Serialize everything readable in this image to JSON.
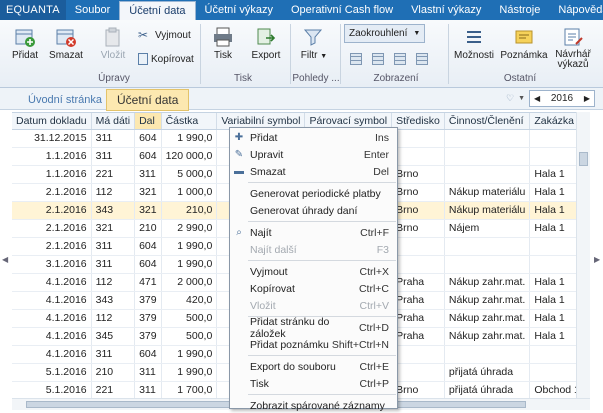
{
  "menubar": {
    "logo": "EQUANTA",
    "tabs": [
      "Soubor",
      "Účetní data",
      "Účetní výkazy",
      "Operativní Cash flow",
      "Vlastní výkazy",
      "Nástroje",
      "Nápověda"
    ]
  },
  "ribbon": {
    "pridat": "Přidat",
    "smazat": "Smazat",
    "vlozit": "Vložit",
    "vyjmout": "Vyjmout",
    "kopirovat": "Kopírovat",
    "upravy": "Úpravy",
    "tisk": "Tisk",
    "export": "Export",
    "tisk_group": "Tisk",
    "filtr": "Filtr",
    "pohledy": "Pohledy ...",
    "zaokrouhleni": "Zaokrouhlení",
    "zobrazeni": "Zobrazení",
    "moznosti": "Možnosti",
    "poznamka": "Poznámka",
    "navrhar": "Návrhář výkazů",
    "ostatni": "Ostatní"
  },
  "pagetabs": {
    "uvodni": "Úvodní stránka",
    "ucetni": "Účetní data",
    "year": "2016"
  },
  "table": {
    "columns": [
      "Datum dokladu",
      "Má dáti",
      "Dal",
      "Částka",
      "Variabilní symbol",
      "Párovací symbol",
      "Středisko",
      "Činnost/Členění",
      "Zakázka",
      "Č"
    ],
    "rows": [
      [
        "31.12.2015",
        "311",
        "604",
        "1 990,0",
        "",
        "",
        "",
        "",
        ""
      ],
      [
        "1.1.2016",
        "311",
        "604",
        "120 000,0",
        "",
        "",
        "",
        "",
        ""
      ],
      [
        "1.1.2016",
        "221",
        "311",
        "5 000,0",
        "",
        "",
        "Brno",
        "",
        "Hala 1"
      ],
      [
        "2.1.2016",
        "112",
        "321",
        "1 000,0",
        "",
        "",
        "Brno",
        "Nákup materiálu",
        "Hala 1"
      ],
      [
        "2.1.2016",
        "343",
        "321",
        "210,0",
        "",
        "",
        "Brno",
        "Nákup materiálu",
        "Hala 1"
      ],
      [
        "2.1.2016",
        "321",
        "210",
        "2 990,0",
        "",
        "",
        "Brno",
        "Nájem",
        "Hala 1"
      ],
      [
        "2.1.2016",
        "311",
        "604",
        "1 990,0",
        "",
        "",
        "",
        "",
        ""
      ],
      [
        "3.1.2016",
        "311",
        "604",
        "1 990,0",
        "",
        "",
        "",
        "",
        ""
      ],
      [
        "4.1.2016",
        "112",
        "471",
        "2 000,0",
        "",
        "",
        "Praha",
        "Nákup zahr.mat.",
        "Hala 1"
      ],
      [
        "4.1.2016",
        "343",
        "379",
        "420,0",
        "",
        "",
        "Praha",
        "Nákup zahr.mat.",
        "Hala 1"
      ],
      [
        "4.1.2016",
        "112",
        "379",
        "500,0",
        "",
        "",
        "Praha",
        "Nákup zahr.mat.",
        "Hala 1"
      ],
      [
        "4.1.2016",
        "345",
        "379",
        "500,0",
        "",
        "",
        "Praha",
        "Nákup zahr.mat.",
        "Hala 1"
      ],
      [
        "4.1.2016",
        "311",
        "604",
        "1 990,0",
        "",
        "",
        "",
        "",
        ""
      ],
      [
        "5.1.2016",
        "210",
        "311",
        "1 990,0",
        "",
        "",
        "",
        "přijatá úhrada",
        ""
      ],
      [
        "5.1.2016",
        "221",
        "311",
        "1 700,0",
        "",
        "",
        "Brno",
        "přijatá úhrada",
        "Obchod 1"
      ],
      [
        "5.1.2016",
        "311",
        "604",
        "1 990,0",
        "",
        "",
        "",
        "",
        ""
      ]
    ]
  },
  "context_menu": {
    "items": [
      {
        "label": "Přidat",
        "shortcut": "Ins",
        "icon": "add-icon",
        "disabled": false
      },
      {
        "label": "Upravit",
        "shortcut": "Enter",
        "icon": "pencil-icon",
        "disabled": false
      },
      {
        "label": "Smazat",
        "shortcut": "Del",
        "icon": "delete-icon",
        "disabled": false
      },
      {
        "label": "Generovat periodické platby",
        "shortcut": "",
        "icon": "",
        "disabled": false
      },
      {
        "label": "Generovat úhrady daní",
        "shortcut": "",
        "icon": "",
        "disabled": false
      },
      {
        "label": "Najít",
        "shortcut": "Ctrl+F",
        "icon": "search-icon",
        "disabled": false
      },
      {
        "label": "Najít další",
        "shortcut": "F3",
        "icon": "",
        "disabled": true
      },
      {
        "label": "Vyjmout",
        "shortcut": "Ctrl+X",
        "icon": "",
        "disabled": false
      },
      {
        "label": "Kopírovat",
        "shortcut": "Ctrl+C",
        "icon": "",
        "disabled": false
      },
      {
        "label": "Vložit",
        "shortcut": "Ctrl+V",
        "icon": "",
        "disabled": true
      },
      {
        "label": "Přidat stránku do záložek",
        "shortcut": "Ctrl+D",
        "icon": "",
        "disabled": false
      },
      {
        "label": "Přidat poznámku",
        "shortcut": "Shift+Ctrl+N",
        "icon": "",
        "disabled": false
      },
      {
        "label": "Export do souboru",
        "shortcut": "Ctrl+E",
        "icon": "",
        "disabled": false
      },
      {
        "label": "Tisk",
        "shortcut": "Ctrl+P",
        "icon": "",
        "disabled": false
      },
      {
        "label": "Zobrazit spárované záznamy",
        "shortcut": "",
        "icon": "",
        "disabled": false
      }
    ]
  },
  "colors": {
    "accent": "#1f6fb5",
    "highlight": "#fce8b0"
  }
}
